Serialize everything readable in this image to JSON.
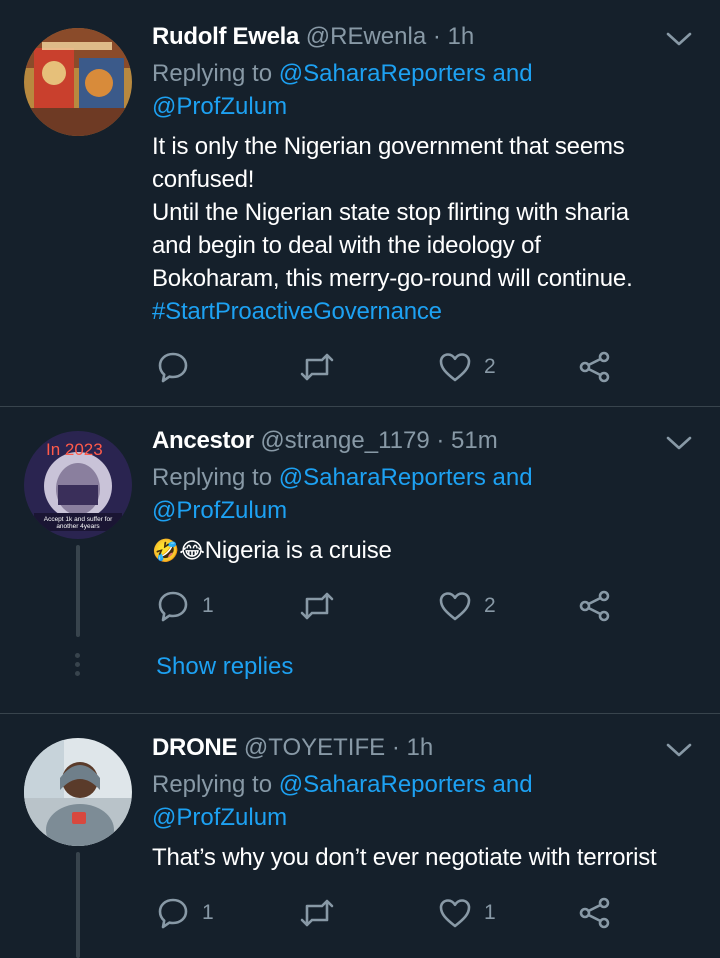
{
  "tweets": [
    {
      "name": "Rudolf Ewela",
      "handle": "@REwenla",
      "time": "· 1h",
      "replying_prefix": "Replying to ",
      "replying_to_1": "@SaharaReporters and",
      "replying_to_2": "@ProfZulum",
      "body_lines": [
        "It is only the Nigerian government that seems",
        "confused!",
        "Until the Nigerian state stop flirting with sharia",
        "and begin to deal with the ideology of",
        "Bokoharam, this merry-go-round will continue."
      ],
      "hashtag": "#StartProactiveGovernance",
      "replies": "",
      "likes": "2"
    },
    {
      "name": "Ancestor",
      "handle": "@strange_1179",
      "time": "· 51m",
      "replying_prefix": "Replying to ",
      "replying_to_1": "@SaharaReporters and",
      "replying_to_2": "@ProfZulum",
      "body": "Nigeria is a cruise",
      "emoji": "🤣😂",
      "avatar_text_top": "In 2023",
      "avatar_text_bottom": "Accept 1k and suffer for another 4years",
      "replies": "1",
      "likes": "2",
      "show_replies": "Show replies"
    },
    {
      "name": "DRONE",
      "handle": "@TOYETIFE",
      "time": "· 1h",
      "replying_prefix": "Replying to ",
      "replying_to_1": "@SaharaReporters and",
      "replying_to_2": "@ProfZulum",
      "body": "That’s why you don’t ever negotiate with terrorist",
      "replies": "1",
      "likes": "1"
    }
  ],
  "colors": {
    "background": "#15202b",
    "accent": "#1da1f2",
    "secondary_text": "#8899a6",
    "divider": "#38444d"
  },
  "icons": [
    "chevron-down-icon",
    "reply-icon",
    "retweet-icon",
    "like-icon",
    "share-icon"
  ]
}
